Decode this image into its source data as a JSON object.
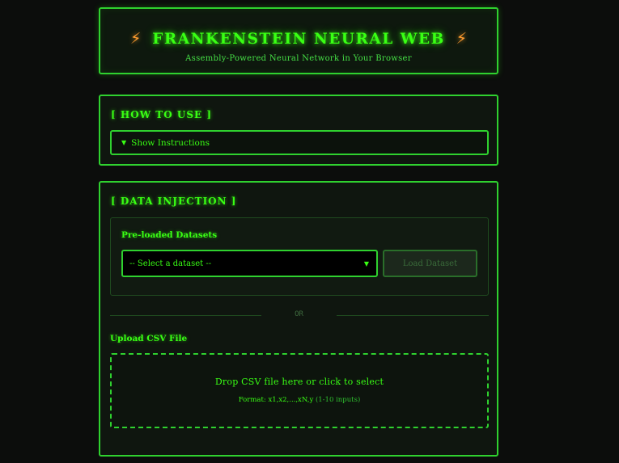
{
  "header": {
    "bolt_left": "⚡",
    "bolt_right": "⚡",
    "title": "FRANKENSTEIN NEURAL WEB",
    "subtitle": "Assembly-Powered Neural Network in Your Browser"
  },
  "how_to_use": {
    "heading": "[ HOW TO USE ]",
    "toggle_icon": "▼",
    "toggle_label": "Show Instructions"
  },
  "data_injection": {
    "heading": "[ DATA INJECTION ]",
    "preloaded": {
      "heading": "Pre-loaded Datasets",
      "select_value": "-- Select a dataset --",
      "caret": "▼",
      "load_button": "Load Dataset"
    },
    "divider_text": "OR",
    "upload": {
      "heading": "Upload CSV File",
      "drop_text": "Drop CSV file here or click to select",
      "format_text": "Format: x1,x2,...,xN,y",
      "format_hint": "(1-10 inputs)"
    }
  },
  "colors": {
    "accent": "#39ff14",
    "bolt": "#ff9b2f",
    "background": "#0c0d0c",
    "panel_border": "#2fd12f"
  }
}
